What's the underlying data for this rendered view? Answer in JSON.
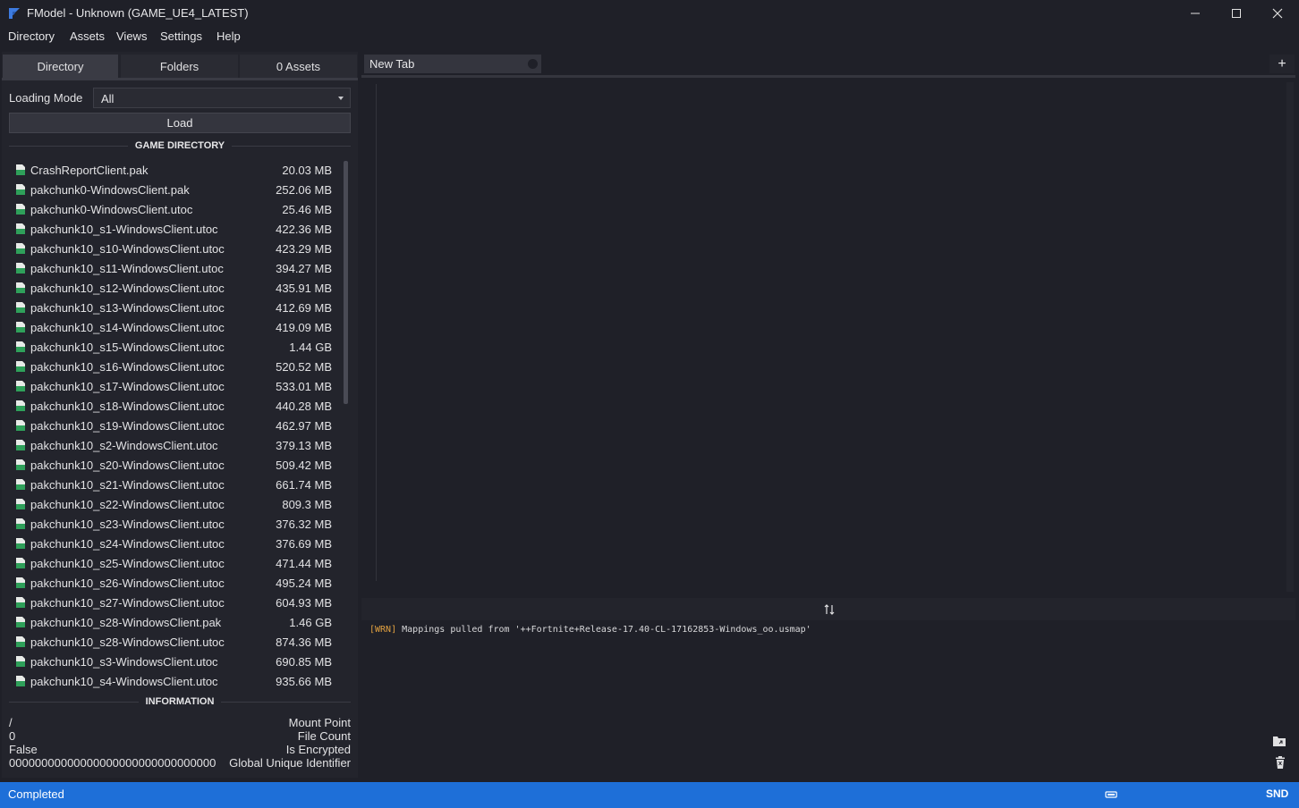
{
  "window": {
    "title": "FModel - Unknown (GAME_UE4_LATEST)"
  },
  "menu": [
    "Directory",
    "Assets",
    "Views",
    "Settings",
    "Help"
  ],
  "left_tabs": [
    {
      "label": "Directory",
      "active": true
    },
    {
      "label": "Folders",
      "active": false
    },
    {
      "label": "0 Assets",
      "active": false
    }
  ],
  "loading_mode": {
    "label": "Loading Mode",
    "value": "All"
  },
  "load_button": "Load",
  "game_directory": {
    "title": "GAME DIRECTORY",
    "files": [
      {
        "name": "CrashReportClient.pak",
        "size": "20.03 MB"
      },
      {
        "name": "pakchunk0-WindowsClient.pak",
        "size": "252.06 MB"
      },
      {
        "name": "pakchunk0-WindowsClient.utoc",
        "size": "25.46 MB"
      },
      {
        "name": "pakchunk10_s1-WindowsClient.utoc",
        "size": "422.36 MB"
      },
      {
        "name": "pakchunk10_s10-WindowsClient.utoc",
        "size": "423.29 MB"
      },
      {
        "name": "pakchunk10_s11-WindowsClient.utoc",
        "size": "394.27 MB"
      },
      {
        "name": "pakchunk10_s12-WindowsClient.utoc",
        "size": "435.91 MB"
      },
      {
        "name": "pakchunk10_s13-WindowsClient.utoc",
        "size": "412.69 MB"
      },
      {
        "name": "pakchunk10_s14-WindowsClient.utoc",
        "size": "419.09 MB"
      },
      {
        "name": "pakchunk10_s15-WindowsClient.utoc",
        "size": "1.44 GB"
      },
      {
        "name": "pakchunk10_s16-WindowsClient.utoc",
        "size": "520.52 MB"
      },
      {
        "name": "pakchunk10_s17-WindowsClient.utoc",
        "size": "533.01 MB"
      },
      {
        "name": "pakchunk10_s18-WindowsClient.utoc",
        "size": "440.28 MB"
      },
      {
        "name": "pakchunk10_s19-WindowsClient.utoc",
        "size": "462.97 MB"
      },
      {
        "name": "pakchunk10_s2-WindowsClient.utoc",
        "size": "379.13 MB"
      },
      {
        "name": "pakchunk10_s20-WindowsClient.utoc",
        "size": "509.42 MB"
      },
      {
        "name": "pakchunk10_s21-WindowsClient.utoc",
        "size": "661.74 MB"
      },
      {
        "name": "pakchunk10_s22-WindowsClient.utoc",
        "size": "809.3 MB"
      },
      {
        "name": "pakchunk10_s23-WindowsClient.utoc",
        "size": "376.32 MB"
      },
      {
        "name": "pakchunk10_s24-WindowsClient.utoc",
        "size": "376.69 MB"
      },
      {
        "name": "pakchunk10_s25-WindowsClient.utoc",
        "size": "471.44 MB"
      },
      {
        "name": "pakchunk10_s26-WindowsClient.utoc",
        "size": "495.24 MB"
      },
      {
        "name": "pakchunk10_s27-WindowsClient.utoc",
        "size": "604.93 MB"
      },
      {
        "name": "pakchunk10_s28-WindowsClient.pak",
        "size": "1.46 GB"
      },
      {
        "name": "pakchunk10_s28-WindowsClient.utoc",
        "size": "874.36 MB"
      },
      {
        "name": "pakchunk10_s3-WindowsClient.utoc",
        "size": "690.85 MB"
      },
      {
        "name": "pakchunk10_s4-WindowsClient.utoc",
        "size": "935.66 MB"
      }
    ]
  },
  "information": {
    "title": "INFORMATION",
    "rows": [
      {
        "value": "/",
        "key": "Mount Point"
      },
      {
        "value": "0",
        "key": "File Count"
      },
      {
        "value": "False",
        "key": "Is Encrypted"
      },
      {
        "value": "00000000000000000000000000000000",
        "key": "Global Unique Identifier"
      }
    ]
  },
  "editor_tab": {
    "label": "New Tab",
    "add": "+"
  },
  "log": {
    "tag": "[WRN]",
    "message": " Mappings pulled from '++Fortnite+Release-17.40-CL-17162853-Windows_oo.usmap'"
  },
  "status": {
    "text": "Completed",
    "right": "SND",
    "bar_color": "#1e6fd8"
  },
  "icons": {
    "app": "fmodel-logo-icon",
    "minimize": "minimize-icon",
    "maximize": "maximize-icon",
    "close": "close-icon",
    "file": "pak-file-icon",
    "splitter": "swap-vertical-icon",
    "log_folder": "folder-icon",
    "log_delete": "trash-icon",
    "status_icon": "keyboard-icon"
  }
}
